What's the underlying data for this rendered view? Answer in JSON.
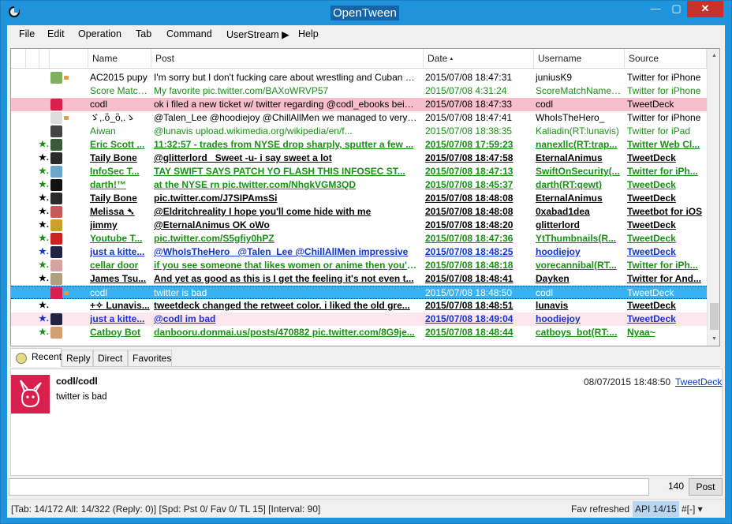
{
  "window": {
    "title": "OpenTween",
    "min": "—",
    "max": "▢",
    "close": "✕"
  },
  "menu": [
    "File",
    "Edit",
    "Operation",
    "Tab",
    "Command",
    "UserStream ▶",
    "Help"
  ],
  "columns": {
    "name": "Name",
    "post": "Post",
    "date": "Date",
    "username": "Username",
    "source": "Source"
  },
  "colors": {
    "accent": "#1f93dc",
    "selected_row": "#37b2f7",
    "reply_row": "#f6bfcb",
    "green_text": "#1a8f15",
    "blue_text": "#1433d0",
    "mention_text": "#5a5a5a"
  },
  "rows": [
    {
      "style": "normal",
      "color": "#000",
      "star": "",
      "avatar": "#7fb060",
      "rt": true,
      "name": "AC2015 pupy",
      "post": "I'm sorry but I don't fucking care about wrestling and Cuban cigars, y'...",
      "date": "2015/07/08 18:47:31",
      "user": "juniusK9",
      "source": "Twitter for iPhone"
    },
    {
      "style": "normal",
      "color": "#1a8f15",
      "star": "",
      "avatar": "",
      "rt": false,
      "name": "Score Match ...",
      "post": "My favorite pic.twitter.com/BAXoWRVP57",
      "date": "2015/07/08 4:31:24",
      "user": "ScoreMatchNames(...",
      "source": "Twitter for iPhone"
    },
    {
      "style": "pink",
      "color": "#000",
      "star": "",
      "avatar": "#d81f4e",
      "rt": false,
      "name": "codl",
      "post": "ok i filed a new ticket w/ twitter regarding @codl_ebooks being restri...",
      "date": "2015/07/08 18:47:33",
      "user": "codl",
      "source": "TweetDeck"
    },
    {
      "style": "normal",
      "color": "#000",
      "star": "",
      "avatar": "#dddddd",
      "rt": true,
      "name": "ゞ,.ὃ_ὃ,.ゝ",
      "post": "@Talen_Lee @hoodiejoy @ChillAllMen we managed to very vaguely...",
      "date": "2015/07/08 18:47:41",
      "user": "WhoIsTheHero_",
      "source": "Twitter for iPhone"
    },
    {
      "style": "normal",
      "color": "#1a8f15",
      "star": "",
      "avatar": "#444444",
      "rt": false,
      "name": "Aiwan",
      "post": "@lunavis  upload.wikimedia.org/wikipedia/en/f...",
      "date": "2015/07/08 18:38:35",
      "user": "Kaliadin(RT:lunavis)",
      "source": "Twitter for iPad"
    },
    {
      "style": "bold",
      "color": "#1a8f15",
      "star": "★.",
      "avatar": "#3a5a3a",
      "rt": false,
      "name": "Eric Scott ...",
      "post": "11:32:57 - trades from NYSE drop sharply, sputter a few ...",
      "date": "2015/07/08 17:59:23",
      "user": "nanexllc(RT:trap...",
      "source": "Twitter Web Cl..."
    },
    {
      "style": "bold",
      "color": "#000",
      "star": "★.",
      "avatar": "#2a2a2a",
      "rt": false,
      "name": "Taily Bone",
      "post": "@glitterlord _Sweet -u- i say sweet a lot",
      "date": "2015/07/08 18:47:58",
      "user": "EternalAnimus",
      "source": "TweetDeck"
    },
    {
      "style": "bold",
      "color": "#1a8f15",
      "star": "★.",
      "avatar": "#6aa7c9",
      "rt": false,
      "name": "InfoSec T...",
      "post": "TAY SWIFT SAYS PATCH YO FLASH THIS INFOSEC ST...",
      "date": "2015/07/08 18:47:13",
      "user": "SwiftOnSecurity(...",
      "source": "Twitter for iPh..."
    },
    {
      "style": "bold",
      "color": "#1a8f15",
      "star": "★.",
      "avatar": "#111111",
      "rt": false,
      "name": "darth!™",
      "post": "at the NYSE rn pic.twitter.com/NhgkVGM3QD",
      "date": "2015/07/08 18:45:37",
      "user": "darth(RT:qewt)",
      "source": "TweetDeck"
    },
    {
      "style": "bold",
      "color": "#000",
      "star": "★.",
      "avatar": "#2a2a2a",
      "rt": false,
      "name": "Taily Bone",
      "post": "pic.twitter.com/J7SIPAmsSi",
      "date": "2015/07/08 18:48:08",
      "user": "EternalAnimus",
      "source": "TweetDeck"
    },
    {
      "style": "bold",
      "color": "#000",
      "star": "★.",
      "avatar": "#c45a5a",
      "rt": false,
      "name": "Melissa ➴",
      "post": "@Eldritchreality I hope you'll come hide with me",
      "date": "2015/07/08 18:48:08",
      "user": "0xabad1dea",
      "source": "Tweetbot for iOS"
    },
    {
      "style": "bold",
      "color": "#000",
      "star": "★.",
      "avatar": "#caa028",
      "rt": false,
      "name": "jimmy",
      "post": "@EternalAnimus OK oWo",
      "date": "2015/07/08 18:48:20",
      "user": "glitterlord",
      "source": "TweetDeck"
    },
    {
      "style": "bold",
      "color": "#1a8f15",
      "star": "★.",
      "avatar": "#cc2222",
      "rt": false,
      "name": "Youtube T...",
      "post": "pic.twitter.com/S5gfiy0hPZ",
      "date": "2015/07/08 18:47:36",
      "user": "YtThumbnails(R...",
      "source": "TweetDeck"
    },
    {
      "style": "bold",
      "color": "#1433d0",
      "star": "★.",
      "avatar": "#222244",
      "rt": false,
      "name": "just a kitte...",
      "post": "@WhoIsTheHero_ @Talen_Lee @ChillAllMen impressive",
      "date": "2015/07/08 18:48:25",
      "user": "hoodiejoy",
      "source": "TweetDeck"
    },
    {
      "style": "bold",
      "color": "#1a8f15",
      "star": "★.",
      "avatar": "#d7a2a2",
      "rt": false,
      "name": "cellar door",
      "post": "if you see someone that likes women or anime then you'r...",
      "date": "2015/07/08 18:48:18",
      "user": "vorecannibal(RT...",
      "source": "Twitter for iPh..."
    },
    {
      "style": "bold",
      "color": "#000",
      "star": "★.",
      "avatar": "#b0a080",
      "rt": false,
      "name": "James Tsu...",
      "post": "And yet as good as this is I get the feeling it's not even t...",
      "date": "2015/07/08 18:48:41",
      "user": "Dayken",
      "source": "Twitter for And..."
    },
    {
      "style": "sel",
      "color": "#fff",
      "star": "",
      "avatar": "#d81f4e",
      "rt": true,
      "name": "codl",
      "post": "twitter is bad",
      "date": "2015/07/08 18:48:50",
      "user": "codl",
      "source": "TweetDeck"
    },
    {
      "style": "bold",
      "color": "#000",
      "star": "★.",
      "avatar": "",
      "rt": false,
      "name": "+✧ Lunavis...",
      "post": "tweetdeck changed the retweet color. i liked the old gre...",
      "date": "2015/07/08 18:48:51",
      "user": "lunavis",
      "source": "TweetDeck"
    },
    {
      "style": "lpink",
      "color": "#1433d0",
      "star": "★.",
      "avatar": "#222244",
      "rt": false,
      "name": "just a kitte...",
      "post": "@codl im bad",
      "date": "2015/07/08 18:49:04",
      "user": "hoodiejoy",
      "source": "TweetDeck"
    },
    {
      "style": "bold",
      "color": "#1a8f15",
      "star": "★.",
      "avatar": "#d5a070",
      "rt": false,
      "name": "Catboy Bot",
      "post": "danbooru.donmai.us/posts/470882 pic.twitter.com/8G9je...",
      "date": "2015/07/08 18:48:44",
      "user": "catboys_bot(RT:...",
      "source": "Nyaa~"
    }
  ],
  "tabs": [
    "Recent",
    "Reply",
    "Direct",
    "Favorites"
  ],
  "detail": {
    "name": "codl/codl",
    "date": "08/07/2015 18:48:50",
    "source": "TweetDeck",
    "text": "twitter is bad"
  },
  "post": {
    "counter": "140",
    "button": "Post"
  },
  "status": {
    "main": "[Tab: 14/172 All: 14/322 (Reply: 0)] [Spd: Pst 0/ Fav 0/ TL 15] [Interval: 90]",
    "fav": "Fav refreshed",
    "api": "API 14/15",
    "tl": "#[-]  ▾"
  }
}
